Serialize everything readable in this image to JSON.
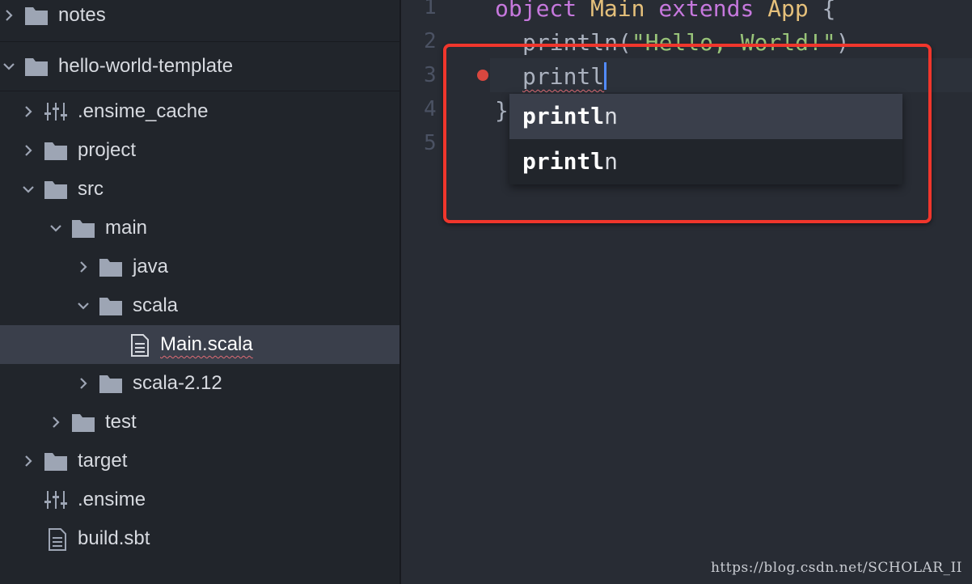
{
  "tree": {
    "items": [
      {
        "label": "notes",
        "icon": "folder-icon",
        "expanded": false
      },
      {
        "label": "hello-world-template",
        "icon": "folder-icon",
        "expanded": true
      },
      {
        "label": ".ensime_cache",
        "icon": "config-icon",
        "expanded": false
      },
      {
        "label": "project",
        "icon": "folder-icon",
        "expanded": false
      },
      {
        "label": "src",
        "icon": "folder-icon",
        "expanded": true
      },
      {
        "label": "main",
        "icon": "folder-icon",
        "expanded": true
      },
      {
        "label": "java",
        "icon": "folder-icon",
        "expanded": false
      },
      {
        "label": "scala",
        "icon": "folder-icon",
        "expanded": true
      },
      {
        "label": "Main.scala",
        "icon": "file-icon",
        "selected": true
      },
      {
        "label": "scala-2.12",
        "icon": "folder-icon",
        "expanded": false
      },
      {
        "label": "test",
        "icon": "folder-icon",
        "expanded": false
      },
      {
        "label": "target",
        "icon": "folder-icon",
        "expanded": false
      },
      {
        "label": ".ensime",
        "icon": "config-icon"
      },
      {
        "label": "build.sbt",
        "icon": "file-icon"
      }
    ]
  },
  "editor": {
    "line_numbers": [
      "1",
      "2",
      "3",
      "4",
      "5"
    ],
    "line1": {
      "kw1": "object",
      "name": "Main",
      "kw2": "extends",
      "parent": "App",
      "brace": "{"
    },
    "line2": {
      "fn": "println(",
      "str": "\"Hello, World!\"",
      "close": ")"
    },
    "line3": {
      "typed": "printl"
    },
    "line4": {
      "brace": "}"
    }
  },
  "autocomplete": {
    "items": [
      {
        "match": "printl",
        "rest": "n"
      },
      {
        "match": "printl",
        "rest": "n"
      }
    ]
  },
  "watermark": "https://blog.csdn.net/SCHOLAR_II",
  "colors": {
    "highlight_box": "#f0362c",
    "breakpoint": "#d9473f",
    "keyword": "#c678dd",
    "type": "#e5c07b",
    "string": "#98c379",
    "caret": "#528bff"
  }
}
